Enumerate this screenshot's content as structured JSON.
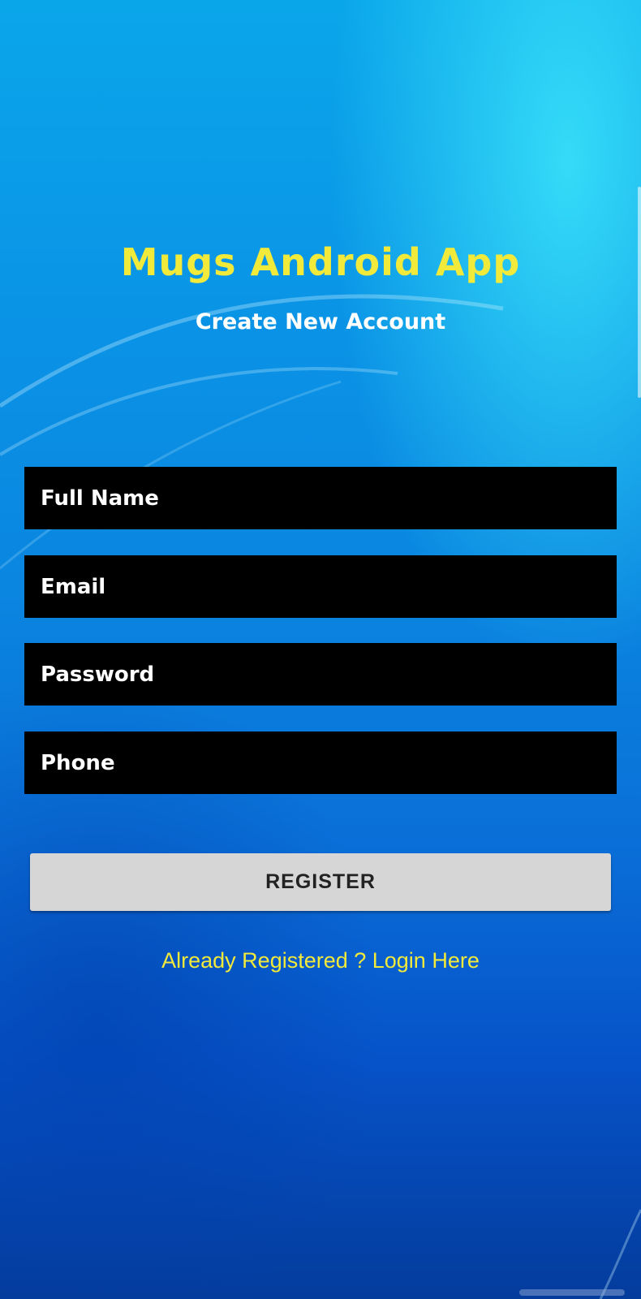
{
  "header": {
    "app_title": "Mugs Android  App",
    "subtitle": "Create New Account"
  },
  "form": {
    "full_name_placeholder": "Full Name",
    "email_placeholder": "Email",
    "password_placeholder": "Password",
    "phone_placeholder": "Phone",
    "register_label": "REGISTER",
    "login_link": "Already Registered ? Login Here"
  },
  "colors": {
    "accent_yellow": "#f2ea3a",
    "field_background": "#000000",
    "button_background": "#d6d6d6",
    "background_blue": "#0a86e0"
  }
}
